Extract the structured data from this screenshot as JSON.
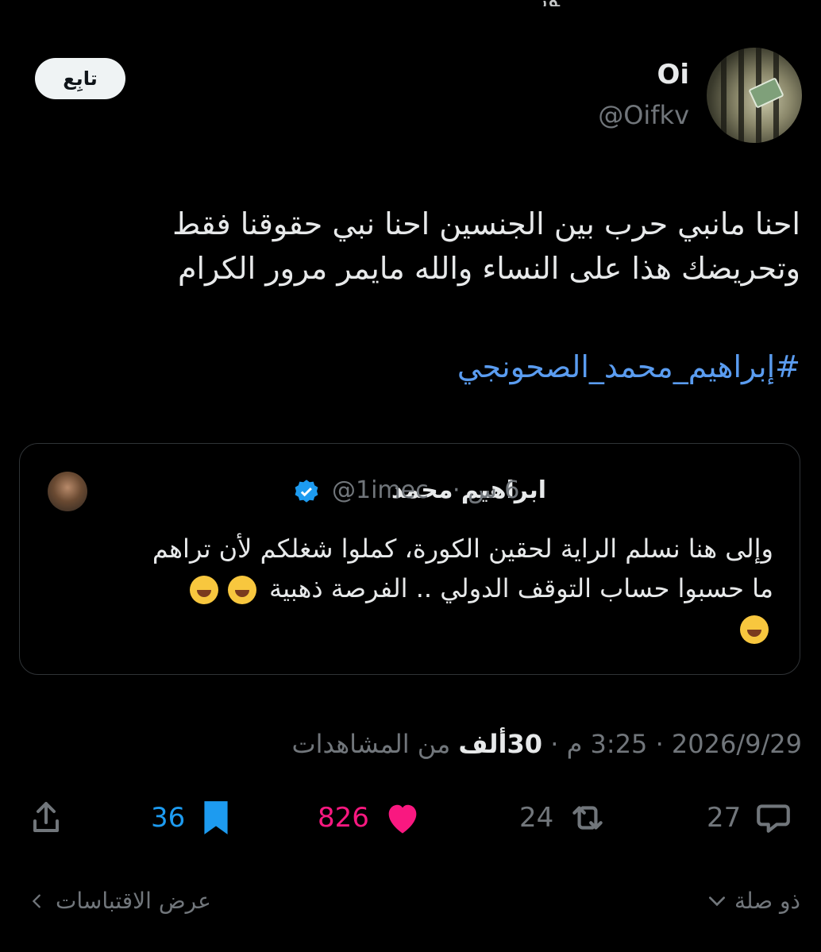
{
  "header": {
    "top_cut_text": "ﻮﺭ",
    "follow_label": "تابِع"
  },
  "author": {
    "name": "Oi",
    "handle": "@Oifkv"
  },
  "tweet": {
    "line1": "احنا مانبي حرب بين الجنسين احنا نبي حقوقنا فقط",
    "line2": "وتحريضك هذا على النساء والله مايمر مرور الكرام",
    "hashtag": "#إبراهيم_محمد_الصحونجي"
  },
  "quote": {
    "name": "ابراهيم محمد",
    "handle": "@1imec",
    "time": "6 س ·",
    "line1": "وإلى هنا نسلم الراية لحقين الكورة، كملوا شغلكم لأن تراهم",
    "line2": "ما حسبوا حساب التوقف الدولي .. الفرصة ذهبية",
    "emoji": "face-with-tears-of-joy"
  },
  "meta": {
    "date": "2026/9/29",
    "time": "3:25 م",
    "views_count": "30ألف",
    "views_label": "من المشاهدات"
  },
  "actions": {
    "replies": "27",
    "reposts": "24",
    "likes": "826",
    "bookmarks": "36"
  },
  "footer": {
    "relevance_label": "ذو صلة",
    "quotes_label": "عرض الاقتباسات"
  },
  "colors": {
    "background": "#000000",
    "text": "#e7e9ea",
    "secondary": "#71767b",
    "link": "#1d9bf0",
    "like": "#f91880",
    "bookmark": "#1d9bf0"
  }
}
